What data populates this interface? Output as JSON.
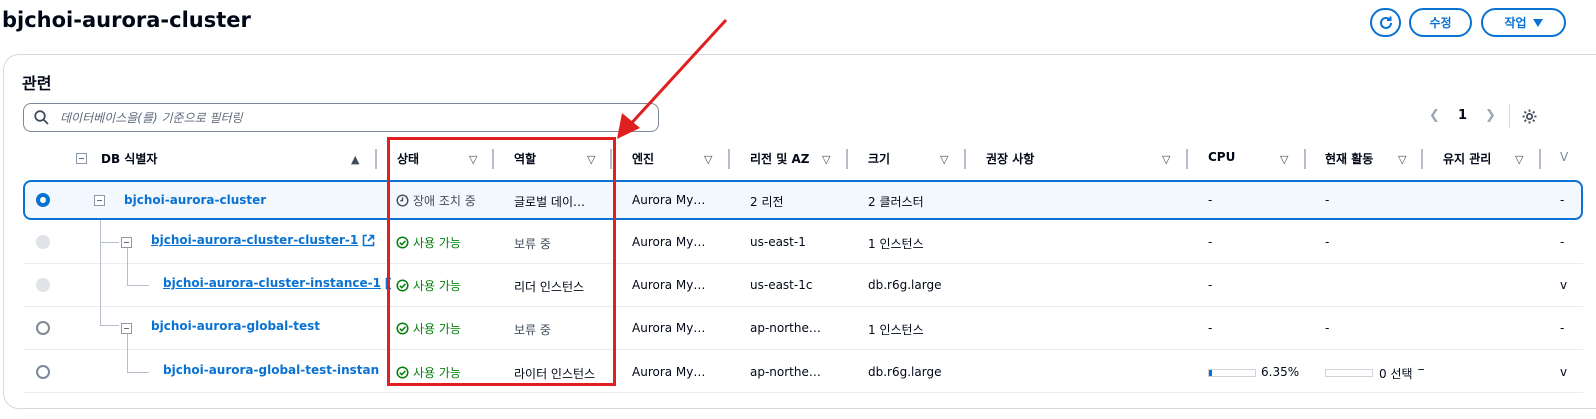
{
  "header": {
    "title": "bjchoi-aurora-cluster",
    "edit_label": "수정",
    "actions_label": "작업"
  },
  "panel": {
    "title": "관련",
    "search_placeholder": "데이터베이스을(를) 기준으로 필터링",
    "page": "1"
  },
  "columns": {
    "db_id": "DB 식별자",
    "status": "상태",
    "role": "역할",
    "engine": "엔진",
    "region_az": "리전 및 AZ",
    "size": "크기",
    "recommendations": "권장 사항",
    "cpu": "CPU",
    "activity": "현재 활동",
    "maintenance": "유지 관리",
    "more": "V"
  },
  "rows": [
    {
      "id": "bjchoi-aurora-cluster",
      "status": "장애 조치 중",
      "role": "글로벌 데이…",
      "engine": "Aurora My…",
      "region": "2 리전",
      "size": "2 클러스터",
      "cpu": "-",
      "activity": "-",
      "extra": "-"
    },
    {
      "id": "bjchoi-aurora-cluster-cluster-1",
      "status": "사용 가능",
      "role": "보류 중",
      "engine": "Aurora My…",
      "region": "us-east-1",
      "size": "1 인스턴스",
      "cpu": "-",
      "activity": "-",
      "extra": "-"
    },
    {
      "id": "bjchoi-aurora-cluster-instance-1",
      "status": "사용 가능",
      "role": "리더 인스턴스",
      "engine": "Aurora My…",
      "region": "us-east-1c",
      "size": "db.r6g.large",
      "cpu": "-",
      "activity": "",
      "extra": "v"
    },
    {
      "id": "bjchoi-aurora-global-test",
      "status": "사용 가능",
      "role": "보류 중",
      "engine": "Aurora My…",
      "region": "ap-northe…",
      "size": "1 인스턴스",
      "cpu": "-",
      "activity": "-",
      "extra": "-"
    },
    {
      "id": "bjchoi-aurora-global-test-instan",
      "status": "사용 가능",
      "role": "라이터 인스턴스",
      "engine": "Aurora My…",
      "region": "ap-northe…",
      "size": "db.r6g.large",
      "cpu": "6.35%",
      "cpu_fraction": 0.0635,
      "activity": "0 선택 ᄀ",
      "activity_fraction": 0.0,
      "extra": "v"
    }
  ],
  "colors": {
    "link": "#0972d3",
    "available": "#037f0c",
    "annotation": "#e02020"
  }
}
